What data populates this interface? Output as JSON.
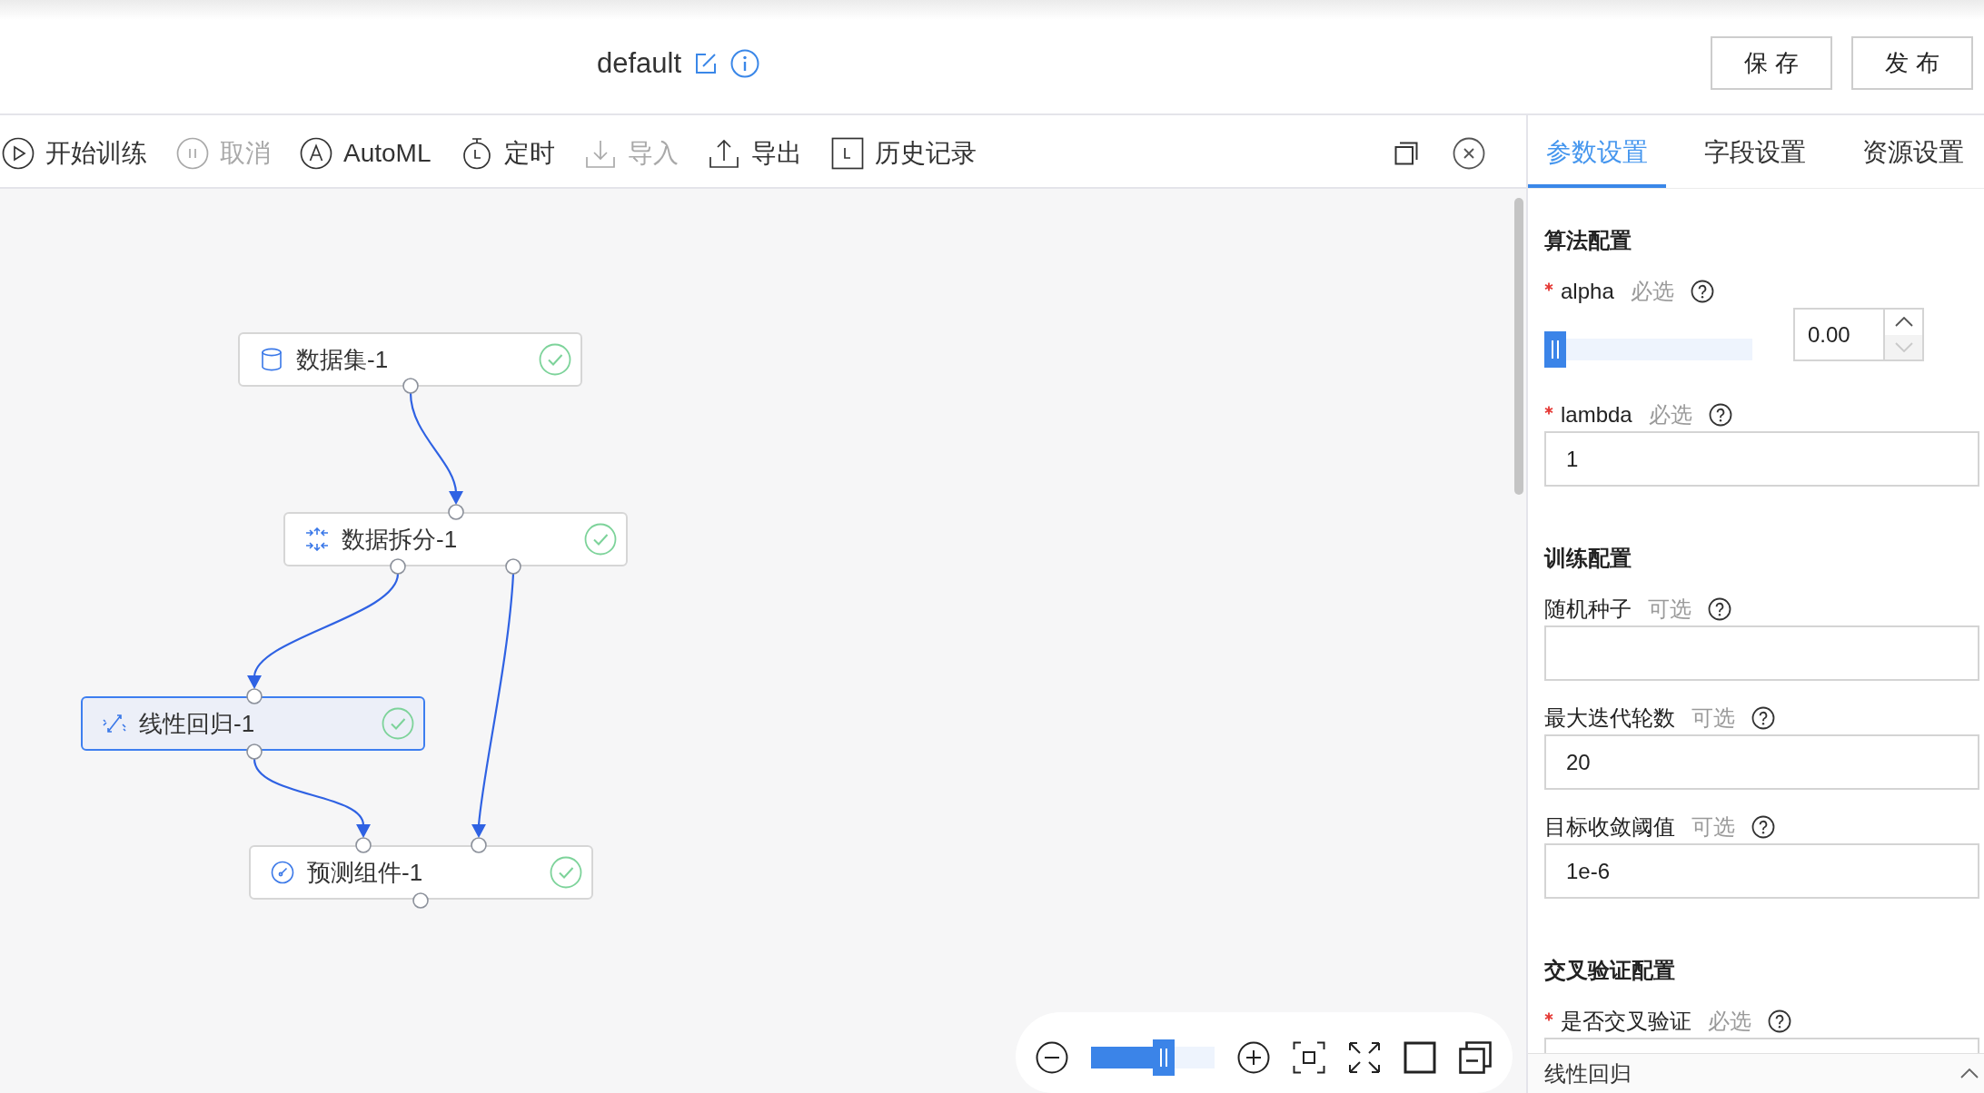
{
  "header": {
    "title": "default",
    "buttons": [
      {
        "label": "保 存"
      },
      {
        "label": "发 布"
      }
    ]
  },
  "toolbar": {
    "items": [
      {
        "kind": "start",
        "label": "开始训练",
        "disabled": false
      },
      {
        "kind": "cancel",
        "label": "取消",
        "disabled": true
      },
      {
        "kind": "automl",
        "label": "AutoML",
        "disabled": false
      },
      {
        "kind": "timer",
        "label": "定时",
        "disabled": false
      },
      {
        "kind": "import",
        "label": "导入",
        "disabled": true
      },
      {
        "kind": "export",
        "label": "导出",
        "disabled": false
      },
      {
        "kind": "history",
        "label": "历史记录",
        "disabled": false
      }
    ]
  },
  "canvas": {
    "nodes": [
      {
        "kind": "dataset",
        "label": "数据集-1",
        "done": true,
        "selected": false
      },
      {
        "kind": "split",
        "label": "数据拆分-1",
        "done": true,
        "selected": false
      },
      {
        "kind": "regression",
        "label": "线性回归-1",
        "done": true,
        "selected": true
      },
      {
        "kind": "predict",
        "label": "预测组件-1",
        "done": true,
        "selected": false
      }
    ],
    "zoom_slider": {
      "level": 0.5
    }
  },
  "panel": {
    "tabs": [
      {
        "label": "参数设置",
        "selected": true
      },
      {
        "label": "字段设置",
        "selected": false
      },
      {
        "label": "资源设置",
        "selected": false
      }
    ],
    "sections": [
      {
        "title": "算法配置",
        "fields": [
          {
            "kind": "slider",
            "label": "alpha",
            "required": true,
            "hint": "必选",
            "level": 0,
            "value": "0.00",
            "decrease_disabled": true
          },
          {
            "kind": "input",
            "label": "lambda",
            "required": true,
            "hint": "必选",
            "value": "1"
          }
        ]
      },
      {
        "title": "训练配置",
        "fields": [
          {
            "kind": "input",
            "label": "随机种子",
            "required": false,
            "hint": "可选"
          },
          {
            "kind": "input",
            "label": "最大迭代轮数",
            "required": false,
            "hint": "可选",
            "value": "20"
          },
          {
            "kind": "input",
            "label": "目标收敛阈值",
            "required": false,
            "hint": "可选",
            "value": "1e-6"
          }
        ]
      },
      {
        "title": "交叉验证配置",
        "fields": [
          {
            "kind": "select",
            "label": "是否交叉验证",
            "required": true,
            "hint": "必选"
          }
        ]
      }
    ],
    "footer": {
      "title": "线性回归"
    }
  }
}
